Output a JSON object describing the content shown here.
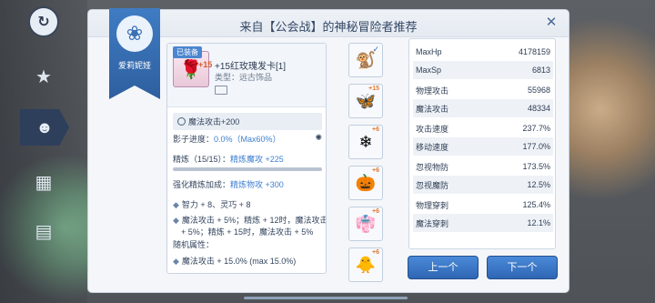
{
  "header": {
    "title": "来自【公会战】的神秘冒险者推荐"
  },
  "ribbon": {
    "name": "爱莉妮娅"
  },
  "item": {
    "equipped_badge": "已装备",
    "refine_plus": "+15",
    "name": "+15红玫瑰发卡[1]",
    "type": "类型：远古饰品",
    "base_attr": "魔法攻击+200",
    "shadow_label": "影子进度：",
    "shadow_value": "0.0%（Max60%）",
    "refine_label": "精炼（15/15）：",
    "refine_value": "精炼魔攻 +225",
    "refine_bonus_label": "强化精炼加成：",
    "refine_bonus_value": "精炼物攻 +300",
    "effects": [
      "智力 + 8、灵巧 + 8",
      "魔法攻击 + 5%；精炼 + 12时，魔法攻击",
      "+ 5%；精炼 + 15时，魔法攻击 + 5%"
    ],
    "random_label": "随机属性：",
    "random_effects": [
      "魔法攻击 + 15.0% (max 15.0%)"
    ]
  },
  "slots": [
    {
      "icon": "🐒",
      "badge": "✓"
    },
    {
      "icon": "🦋",
      "badge": "+15"
    },
    {
      "icon": "❄",
      "badge": "+6"
    },
    {
      "icon": "🎃",
      "badge": "+6"
    },
    {
      "icon": "👘",
      "badge": "+6"
    },
    {
      "icon": "🐥",
      "badge": "+6"
    }
  ],
  "stats": [
    {
      "label": "MaxHp",
      "value": "4178159"
    },
    {
      "label": "MaxSp",
      "value": "6813"
    },
    {
      "label": "物理攻击",
      "value": "55968"
    },
    {
      "label": "魔法攻击",
      "value": "48334"
    },
    {
      "label": "攻击速度",
      "value": "237.7%"
    },
    {
      "label": "移动速度",
      "value": "177.0%"
    },
    {
      "label": "忽视物防",
      "value": "173.5%"
    },
    {
      "label": "忽视魔防",
      "value": "12.5%"
    },
    {
      "label": "物理穿刺",
      "value": "125.4%"
    },
    {
      "label": "魔法穿刺",
      "value": "12.1%"
    }
  ],
  "buttons": {
    "prev": "上一个",
    "next": "下一个"
  },
  "close_icon": "✕"
}
